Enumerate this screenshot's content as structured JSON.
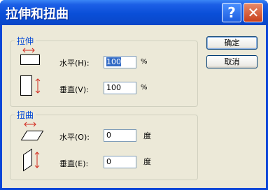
{
  "window": {
    "title": "拉伸和扭曲",
    "help_icon": "?",
    "close_icon": "✕"
  },
  "stretch": {
    "group_title": "拉伸",
    "horizontal_label": "水平(H):",
    "horizontal_value": "100",
    "horizontal_unit": "%",
    "vertical_label": "垂直(V):",
    "vertical_value": "100",
    "vertical_unit": "%"
  },
  "skew": {
    "group_title": "扭曲",
    "horizontal_label": "水平(O):",
    "horizontal_value": "0",
    "horizontal_unit": "度",
    "vertical_label": "垂直(E):",
    "vertical_value": "0",
    "vertical_unit": "度"
  },
  "buttons": {
    "ok": "确定",
    "cancel": "取消"
  },
  "colors": {
    "titlebar": "#0a4fd8",
    "group_title": "#0046d5",
    "arrow": "#d22b1f",
    "selection": "#316ac5"
  }
}
